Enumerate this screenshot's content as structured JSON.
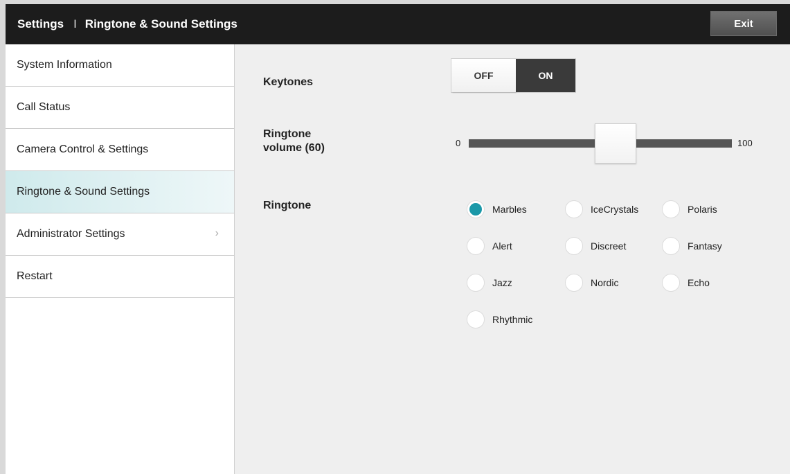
{
  "header": {
    "title_left": "Settings",
    "separator": "I",
    "title_right": "Ringtone & Sound Settings",
    "exit_label": "Exit"
  },
  "sidebar": {
    "items": [
      {
        "label": "System Information",
        "active": false
      },
      {
        "label": "Call Status",
        "active": false
      },
      {
        "label": "Camera Control & Settings",
        "active": false
      },
      {
        "label": "Ringtone & Sound Settings",
        "active": true
      },
      {
        "label": "Administrator Settings",
        "active": false,
        "chevron": "›"
      },
      {
        "label": "Restart",
        "active": false
      }
    ]
  },
  "keytones": {
    "label": "Keytones",
    "off_label": "OFF",
    "on_label": "ON",
    "value": "ON"
  },
  "volume": {
    "label_line1": "Ringtone",
    "label_line2": "volume (60)",
    "min_label": "0",
    "max_label": "100",
    "value": 60,
    "min": 0,
    "max": 100
  },
  "ringtone": {
    "label": "Ringtone",
    "selected": "Marbles",
    "options": [
      "Marbles",
      "IceCrystals",
      "Polaris",
      "Alert",
      "Discreet",
      "Fantasy",
      "Jazz",
      "Nordic",
      "Echo",
      "Rhythmic"
    ]
  },
  "colors": {
    "accent": "#1a98a8",
    "header_bg": "#1c1c1c",
    "active_item_bg": "#cfeaec"
  }
}
